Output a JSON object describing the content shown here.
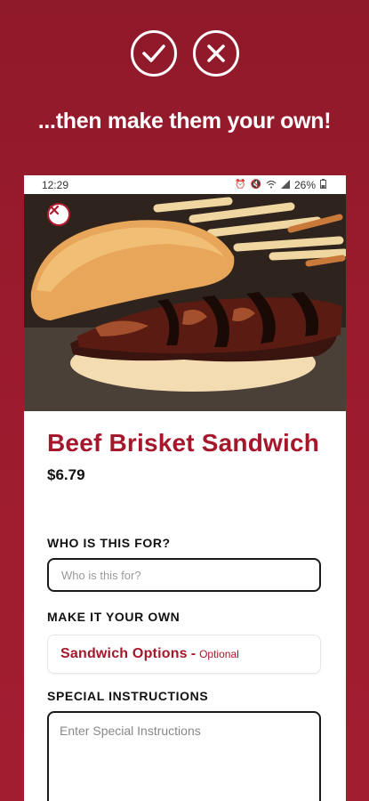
{
  "promo": {
    "headline": "...then make them your own!",
    "icons": [
      "check-circle-icon",
      "x-circle-icon"
    ]
  },
  "status_bar": {
    "time": "12:29",
    "battery": "26%",
    "icons": [
      "alarm-icon",
      "mute-icon",
      "wifi-icon",
      "signal-icon",
      "battery-icon"
    ]
  },
  "item": {
    "title": "Beef Brisket Sandwich",
    "price": "$6.79"
  },
  "who": {
    "label": "WHO IS THIS FOR?",
    "placeholder": "Who is this for?"
  },
  "customize": {
    "label": "MAKE IT YOUR OWN",
    "options_title": "Sandwich Options",
    "separator": "-",
    "options_hint": "Optional"
  },
  "special": {
    "label": "SPECIAL INSTRUCTIONS",
    "placeholder": "Enter Special Instructions"
  },
  "colors": {
    "brand_red": "#a5182c",
    "background": "#9a1b2d"
  }
}
